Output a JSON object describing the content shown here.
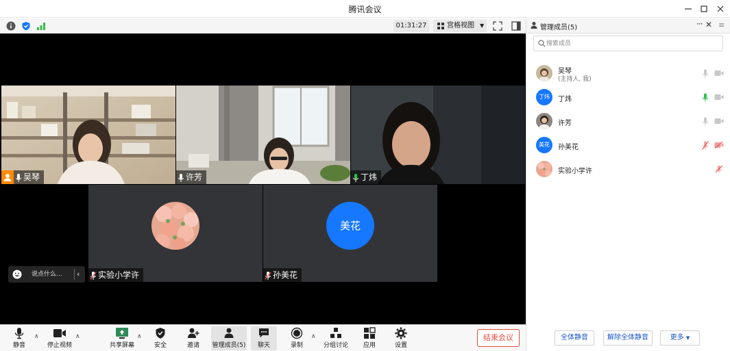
{
  "window": {
    "title": "腾讯会议"
  },
  "meeting": {
    "timer": "01:31:27",
    "view_label": "宫格视图"
  },
  "tiles": [
    {
      "name": "吴琴",
      "host": true
    },
    {
      "name": "许芳",
      "host": false
    },
    {
      "name": "丁炜",
      "host": false
    },
    {
      "name": "实验小学许",
      "host": false
    },
    {
      "name": "孙美花",
      "host": false,
      "avatar_text": "美花"
    }
  ],
  "chat": {
    "placeholder": "说点什么..."
  },
  "toolbar": {
    "mute": "静音",
    "stop_video": "停止视频",
    "share_screen": "共享屏幕",
    "security": "安全",
    "invite": "邀请",
    "manage_members": "管理成员(5)",
    "chat": "聊天",
    "record": "录制",
    "breakout": "分组讨论",
    "apps": "应用",
    "settings": "设置",
    "end_meeting": "结束会议"
  },
  "panel": {
    "title": "管理成员(5)",
    "search_placeholder": "搜索成员",
    "members": [
      {
        "name": "吴琴",
        "sub": "(主持人, 我)"
      },
      {
        "name": "丁炜",
        "avatar_text": "丁炜"
      },
      {
        "name": "许芳"
      },
      {
        "name": "孙美花",
        "avatar_text": "美花"
      },
      {
        "name": "实验小学许"
      }
    ],
    "buttons": {
      "mute_all": "全体静音",
      "unmute_all": "解除全体静音",
      "more": "更多"
    }
  },
  "colors": {
    "accent_blue": "#1677ff",
    "end_red": "#e74c3c",
    "mic_green": "#2fbf4a",
    "muted_red": "#e05a5a",
    "host_orange": "#ff8a00"
  }
}
